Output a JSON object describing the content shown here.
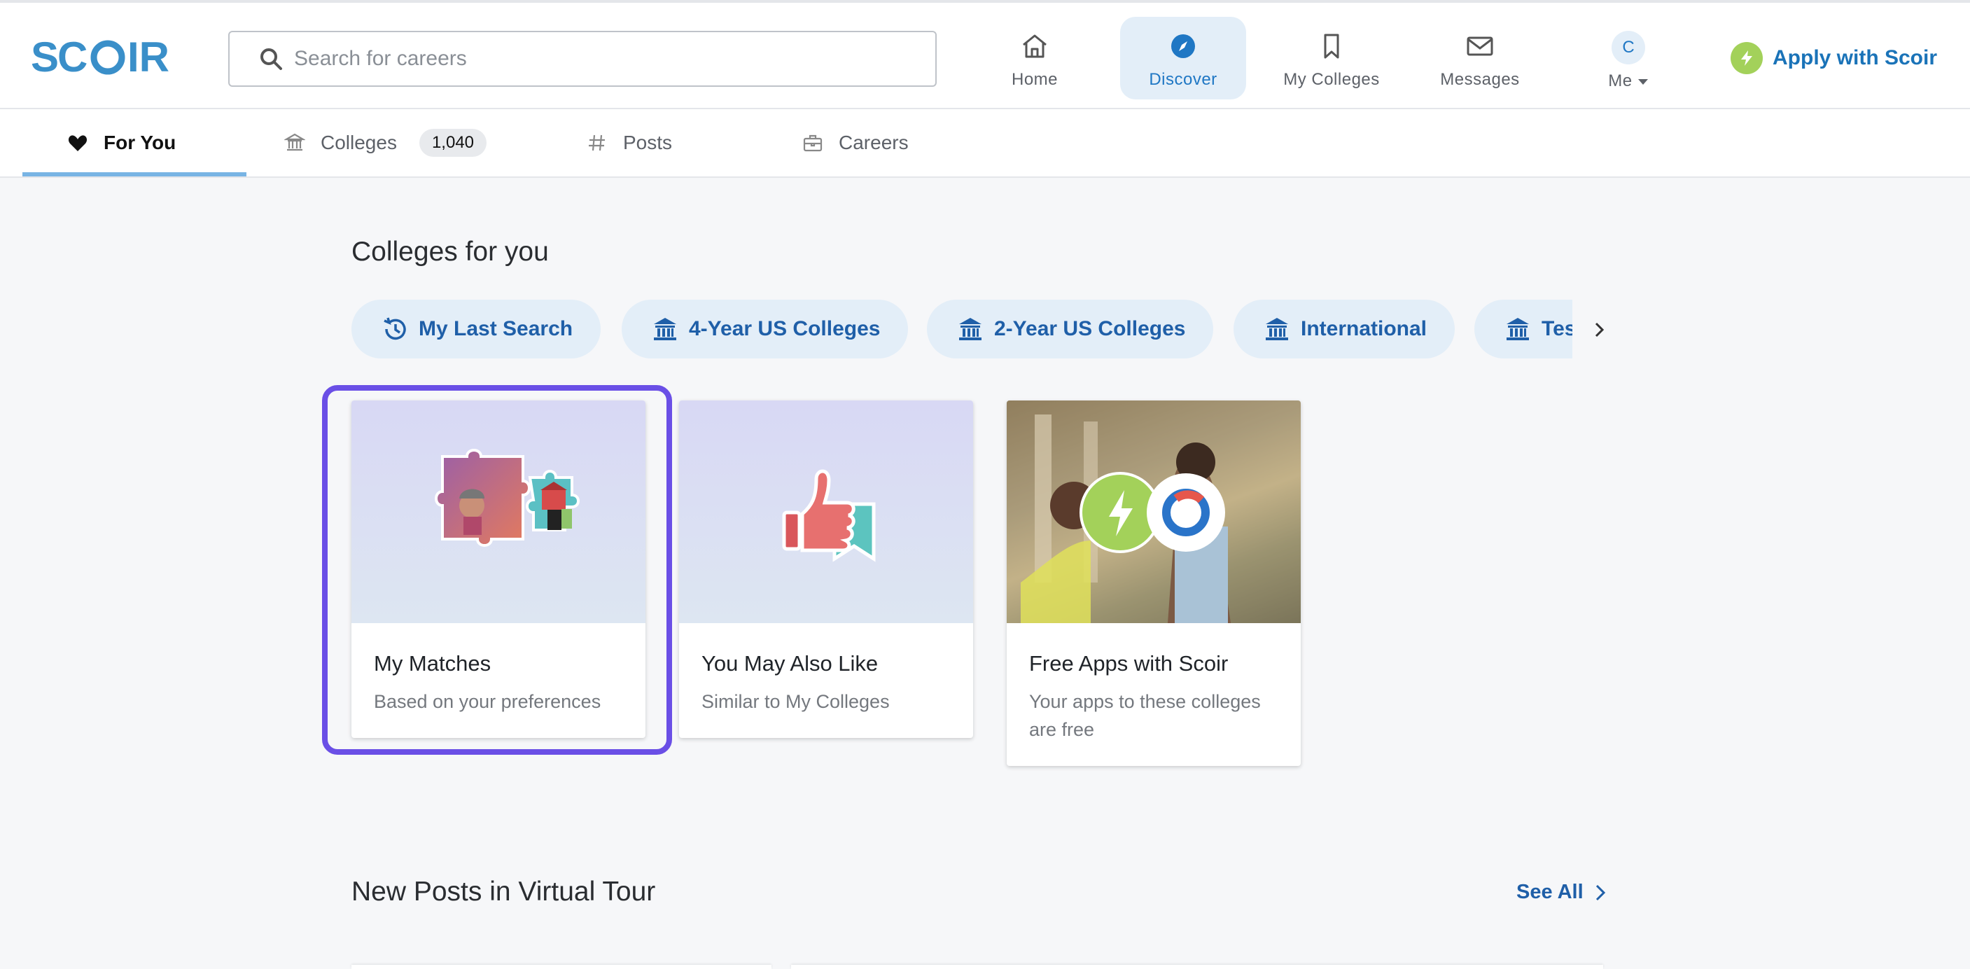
{
  "brand": {
    "logo_text": "SCOIR"
  },
  "search": {
    "placeholder": "Search for careers",
    "value": ""
  },
  "nav": {
    "items": [
      {
        "label": "Home",
        "icon": "home-icon"
      },
      {
        "label": "Discover",
        "icon": "compass-icon",
        "active": true
      },
      {
        "label": "My Colleges",
        "icon": "bookmark-icon"
      },
      {
        "label": "Messages",
        "icon": "mail-icon"
      }
    ],
    "me": {
      "avatar_initial": "C",
      "label": "Me"
    },
    "apply_label": "Apply with Scoir"
  },
  "tabs": {
    "for_you": "For You",
    "colleges": "Colleges",
    "colleges_count": "1,040",
    "posts": "Posts",
    "careers": "Careers"
  },
  "colleges_for_you": {
    "title": "Colleges for you",
    "chips": [
      {
        "label": "My Last Search",
        "icon": "history-icon"
      },
      {
        "label": "4-Year US Colleges",
        "icon": "institution-icon"
      },
      {
        "label": "2-Year US Colleges",
        "icon": "institution-icon"
      },
      {
        "label": "International",
        "icon": "institution-icon"
      },
      {
        "label": "Tes",
        "icon": "institution-icon"
      }
    ],
    "cards": [
      {
        "title": "My Matches",
        "subtitle": "Based on your preferences",
        "selected": true
      },
      {
        "title": "You May Also Like",
        "subtitle": "Similar to My Colleges"
      },
      {
        "title": "Free Apps with Scoir",
        "subtitle": "Your apps to these colleges are free"
      }
    ]
  },
  "virtual_tour": {
    "title": "New Posts in Virtual Tour",
    "see_all": "See All"
  },
  "colors": {
    "accent": "#1f77c4",
    "brand": "#3a8fc9",
    "highlight": "#6a4fe6",
    "apply_green": "#a3d15a"
  }
}
